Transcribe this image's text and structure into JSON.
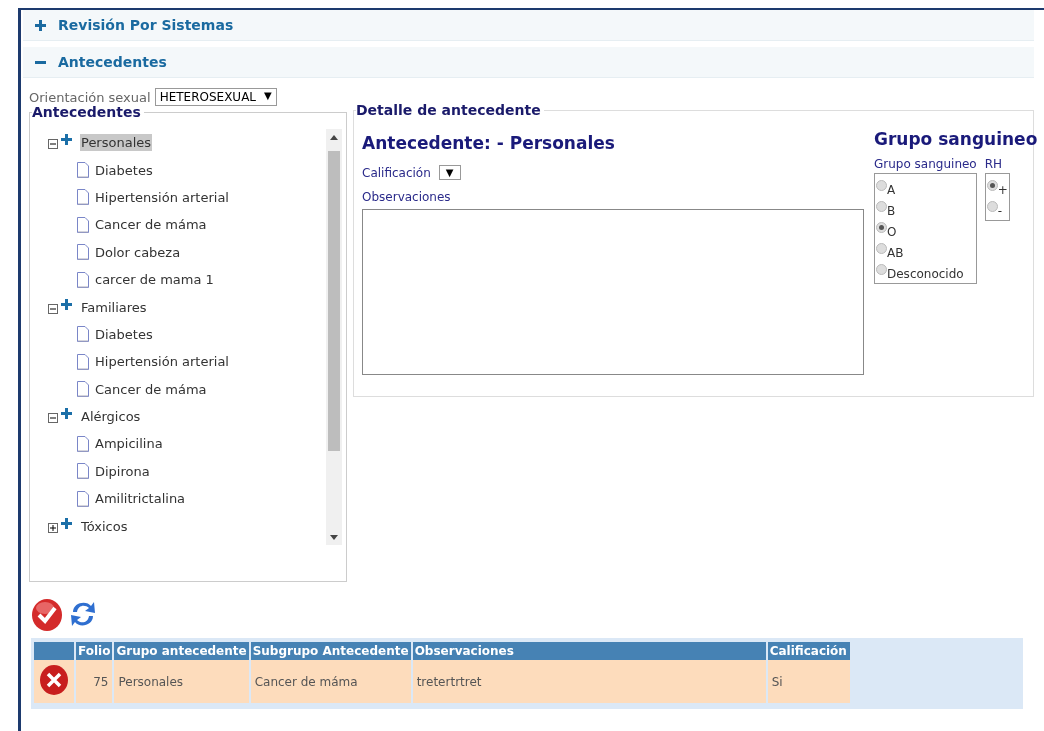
{
  "sections": [
    {
      "title": "Revisión Por Sistemas",
      "expanded": false
    },
    {
      "title": "Antecedentes",
      "expanded": true
    }
  ],
  "orientation": {
    "label": "Orientación sexual",
    "value": "HETEROSEXUAL",
    "arrow": "▼"
  },
  "tree_panel": {
    "title": "Antecedentes",
    "groups": [
      {
        "label": "Personales",
        "expanded": true,
        "selected": true,
        "children": [
          {
            "label": "Diabetes"
          },
          {
            "label": "Hipertensión arterial"
          },
          {
            "label": "Cancer de máma"
          },
          {
            "label": "Dolor cabeza"
          },
          {
            "label": "carcer de mama 1"
          }
        ]
      },
      {
        "label": "Familiares",
        "expanded": true,
        "selected": false,
        "children": [
          {
            "label": "Diabetes"
          },
          {
            "label": "Hipertensión arterial"
          },
          {
            "label": "Cancer de máma"
          }
        ]
      },
      {
        "label": "Alérgicos",
        "expanded": true,
        "selected": false,
        "children": [
          {
            "label": "Ampicilina"
          },
          {
            "label": "Dipirona"
          },
          {
            "label": "Amilitrictalina"
          }
        ]
      },
      {
        "label": "Tóxicos",
        "expanded": false,
        "selected": false
      }
    ]
  },
  "detail": {
    "legend": "Detalle de antecedente",
    "heading": "Antecedente: - Personales",
    "rating_label": "Calificación",
    "rating_arrow": "▼",
    "notes_label": "Observaciones",
    "blood": {
      "title": "Grupo sanguineo",
      "group_label": "Grupo sanguineo",
      "groups": [
        {
          "label": "A",
          "selected": false
        },
        {
          "label": "B",
          "selected": false
        },
        {
          "label": "O",
          "selected": true
        },
        {
          "label": "AB",
          "selected": false
        },
        {
          "label": "Desconocido",
          "selected": false
        }
      ],
      "rh_label": "RH",
      "rh": [
        {
          "label": "+",
          "selected": true
        },
        {
          "label": "-",
          "selected": false
        }
      ]
    }
  },
  "table": {
    "columns": [
      "Folio",
      "Grupo antecedente",
      "Subgrupo Antecedente",
      "Observaciones",
      "Calificación"
    ],
    "rows": [
      [
        "75",
        "Personales",
        "Cancer de máma",
        "tretertrtret",
        "Si"
      ]
    ]
  }
}
